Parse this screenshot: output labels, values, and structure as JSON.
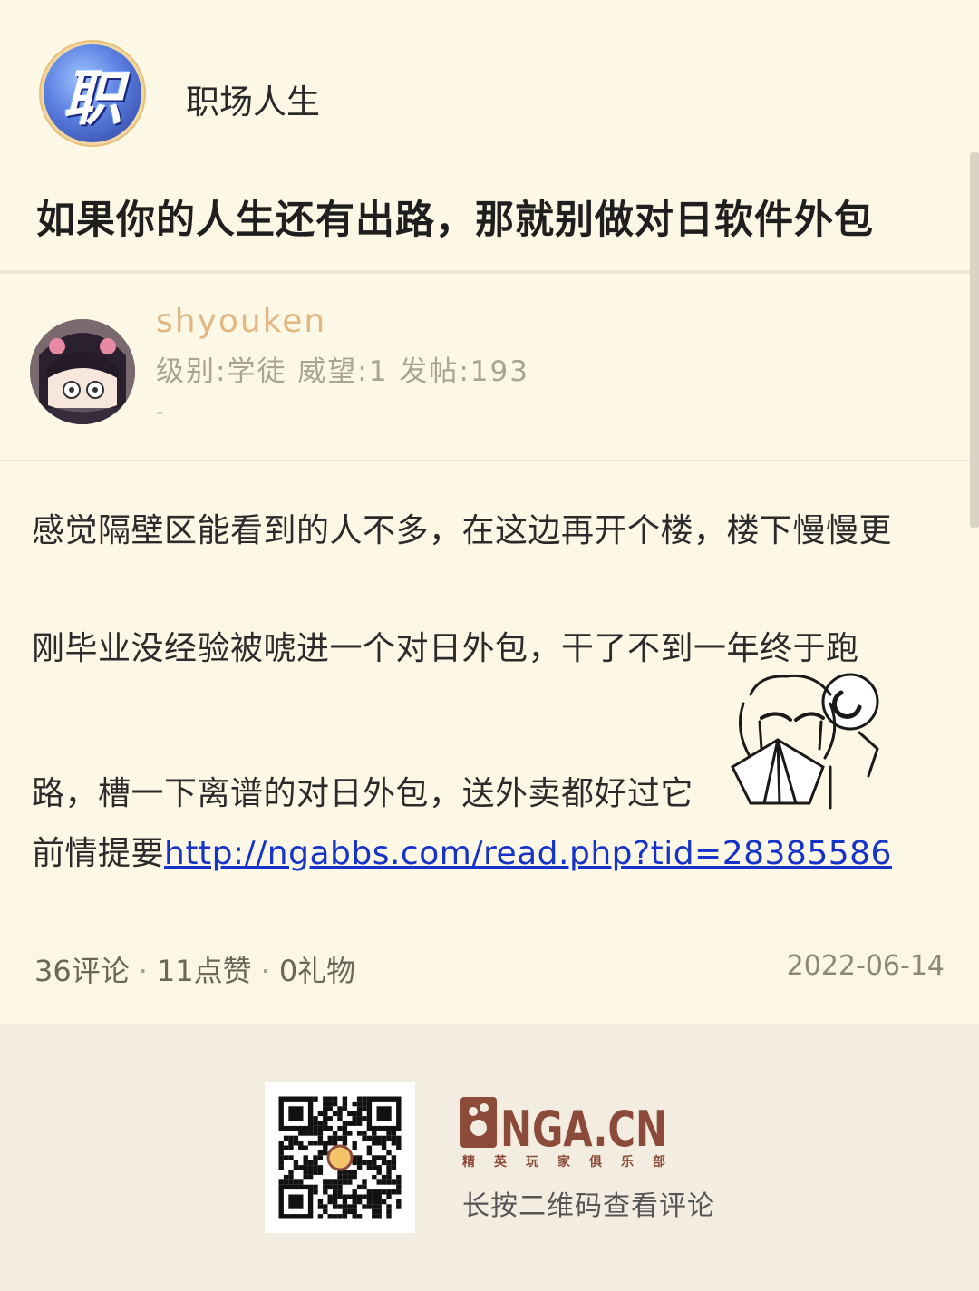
{
  "forum": {
    "name": "职场人生",
    "avatar_glyph": "职"
  },
  "post": {
    "title": "如果你的人生还有出路，那就别做对日软件外包",
    "lines": [
      "感觉隔壁区能看到的人不多，在这边再开个楼，楼下慢慢更",
      "刚毕业没经验被唬进一个对日外包，干了不到一年终于跑",
      "路，槽一下离谱的对日外包，送外卖都好过它"
    ],
    "link_prefix": "前情提要",
    "link_text": "http://ngabbs.com/read.php?tid=28385586"
  },
  "author": {
    "name": "shyouken",
    "meta": "级别:学徒  威望:1  发帖:193",
    "signature": "-"
  },
  "stats": {
    "comments": "36评论",
    "likes": "11点赞",
    "gifts": "0礼物",
    "separator": "·",
    "date": "2022-06-14"
  },
  "footer": {
    "logo_text": "NGA.CN",
    "logo_subtitle": "精 英 玩 家 俱 乐 部",
    "caption": "长按二维码查看评论"
  },
  "colors": {
    "background": "#fdf8e6",
    "author_name": "#e2b784",
    "link": "#1533c8",
    "logo": "#8b4a3a"
  }
}
